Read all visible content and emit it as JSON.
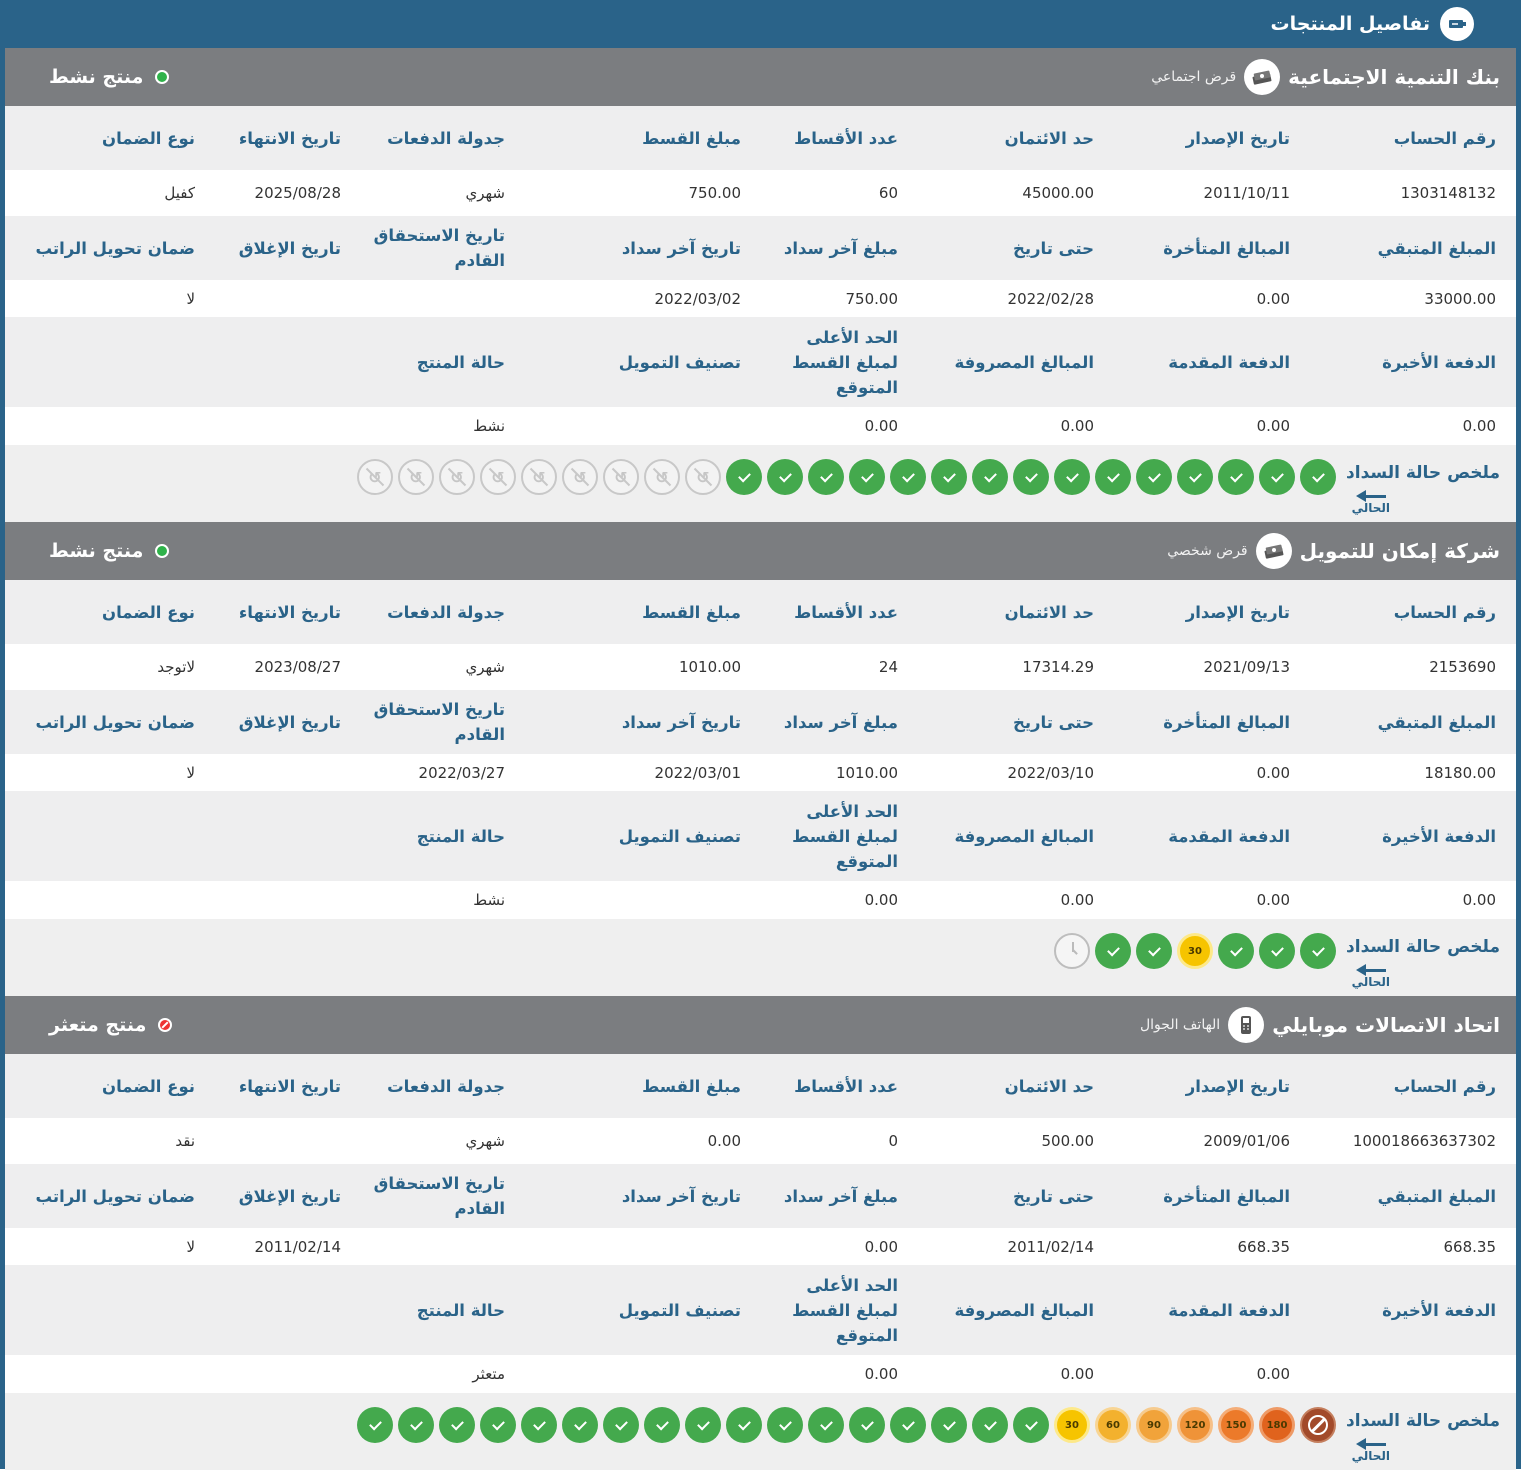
{
  "header": {
    "title": "تفاصيل المنتجات",
    "icon": "product-icon"
  },
  "labels": {
    "row1": [
      "رقم الحساب",
      "تاريخ الإصدار",
      "حد الائتمان",
      "عدد الأقساط",
      "مبلغ القسط",
      "جدولة الدفعات",
      "تاريخ الانتهاء",
      "نوع الضمان"
    ],
    "row2": [
      "المبلغ المتبقي",
      "المبالغ المتأخرة",
      "حتى تاريخ",
      "مبلغ آخر سداد",
      "تاريخ آخر سداد",
      "تاريخ الاستحقاق القادم",
      "تاريخ الإغلاق",
      "ضمان تحويل الراتب"
    ],
    "row3": [
      "الدفعة الأخيرة",
      "الدفعة المقدمة",
      "المبالغ المصروفة",
      "الحد الأعلى لمبلغ القسط المتوقع",
      "تصنيف التمويل",
      "حالة المنتج",
      "",
      ""
    ],
    "payment_summary": "ملخص حالة السداد",
    "current": "الحالي"
  },
  "products": [
    {
      "bank": "بنك التنمية الاجتماعية",
      "type": "قرض اجتماعي",
      "type_icon": "money-icon",
      "status": "منتج نشط",
      "status_kind": "active",
      "row1": [
        "1303148132",
        "2011/10/11",
        "45000.00",
        "60",
        "750.00",
        "شهري",
        "2025/08/28",
        "كفيل"
      ],
      "row2": [
        "33000.00",
        "0.00",
        "2022/02/28",
        "750.00",
        "2022/03/02",
        "",
        "",
        "لا"
      ],
      "row3": [
        "0.00",
        "0.00",
        "0.00",
        "0.00",
        "",
        "نشط",
        "",
        ""
      ],
      "payments": [
        "ok",
        "ok",
        "ok",
        "ok",
        "ok",
        "ok",
        "ok",
        "ok",
        "ok",
        "ok",
        "ok",
        "ok",
        "ok",
        "ok",
        "ok",
        "na",
        "na",
        "na",
        "na",
        "na",
        "na",
        "na",
        "na",
        "na"
      ]
    },
    {
      "bank": "شركة إمكان للتمويل",
      "type": "قرض شخصي",
      "type_icon": "money-icon",
      "status": "منتج نشط",
      "status_kind": "active",
      "row1": [
        "2153690",
        "2021/09/13",
        "17314.29",
        "24",
        "1010.00",
        "شهري",
        "2023/08/27",
        "لاتوجد"
      ],
      "row2": [
        "18180.00",
        "0.00",
        "2022/03/10",
        "1010.00",
        "2022/03/01",
        "2022/03/27",
        "",
        "لا"
      ],
      "row3": [
        "0.00",
        "0.00",
        "0.00",
        "0.00",
        "",
        "نشط",
        "",
        ""
      ],
      "payments": [
        "ok",
        "ok",
        "ok",
        "30",
        "ok",
        "ok",
        "pending"
      ]
    },
    {
      "bank": "اتحاد الاتصالات موبايلي",
      "type": "الهاتف الجوال",
      "type_icon": "mobile-phone-icon",
      "status": "منتج متعثر",
      "status_kind": "bad",
      "row1": [
        "100018663637302",
        "2009/01/06",
        "500.00",
        "0",
        "0.00",
        "شهري",
        "",
        "نقد"
      ],
      "row2": [
        "668.35",
        "668.35",
        "2011/02/14",
        "0.00",
        "",
        "",
        "2011/02/14",
        "لا"
      ],
      "row3": [
        "",
        "0.00",
        "0.00",
        "0.00",
        "",
        "متعثر",
        "",
        ""
      ],
      "payments": [
        "default",
        "180",
        "150",
        "120",
        "90",
        "60",
        "30",
        "ok",
        "ok",
        "ok",
        "ok",
        "ok",
        "ok",
        "ok",
        "ok",
        "ok",
        "ok",
        "ok",
        "ok",
        "ok",
        "ok",
        "ok",
        "ok",
        "ok"
      ]
    }
  ]
}
